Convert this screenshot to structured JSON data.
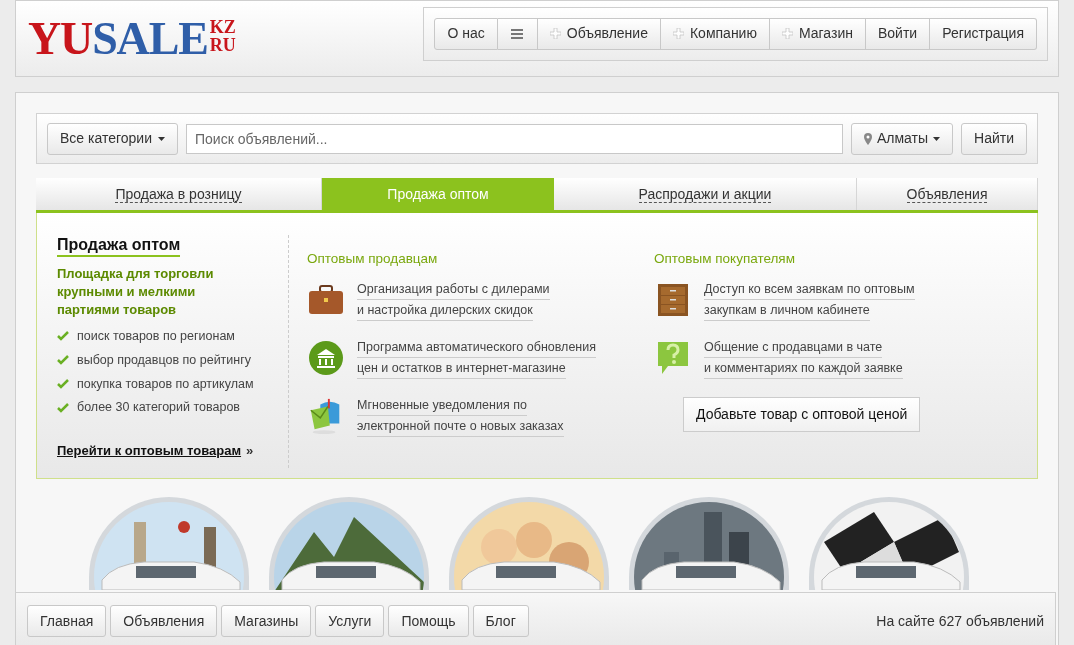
{
  "logo": {
    "main_red": "YU",
    "main_blue": "SALE",
    "top": "KZ",
    "bottom": "RU"
  },
  "nav": [
    {
      "kind": "text",
      "label": "О нас"
    },
    {
      "kind": "menu"
    },
    {
      "kind": "add",
      "label": "Объявление"
    },
    {
      "kind": "add",
      "label": "Компанию"
    },
    {
      "kind": "add",
      "label": "Магазин"
    },
    {
      "kind": "text",
      "label": "Войти"
    },
    {
      "kind": "text",
      "label": "Регистрация"
    }
  ],
  "search": {
    "category": "Все категории",
    "placeholder": "Поиск объявлений...",
    "city": "Алматы",
    "button": "Найти"
  },
  "tabs": [
    {
      "label": "Продажа в розницу",
      "selected": false
    },
    {
      "label": "Продажа оптом",
      "selected": true
    },
    {
      "label": "Распродажи и акции",
      "selected": false
    },
    {
      "label": "Объявления",
      "selected": false
    }
  ],
  "panel": {
    "title": "Продажа оптом",
    "subtitle": "Площадка для торговли крупными и мелкими партиями товаров",
    "features": [
      "поиск товаров по регионам",
      "выбор продавцов по рейтингу",
      "покупка товаров по артикулам",
      "более 30 категорий товаров"
    ],
    "link": "Перейти к оптовым товарам",
    "link_suffix": "»",
    "columns": [
      {
        "heading": "Оптовым продавцам",
        "items": [
          {
            "kind": "briefcase",
            "lines": [
              "Организация работы с дилерами",
              "и настройка дилерских скидок"
            ]
          },
          {
            "kind": "bank",
            "lines": [
              "Программа автоматического обновления",
              "цен и остатков в интернет-магазине"
            ]
          },
          {
            "kind": "mailbox",
            "lines": [
              "Мгновенные уведомления по",
              "электронной почте о новых заказах"
            ]
          }
        ]
      },
      {
        "heading": "Оптовым покупателям",
        "items": [
          {
            "kind": "cabinet",
            "lines": [
              "Доступ ко всем заявкам по оптовым",
              "закупкам в личном кабинете"
            ]
          },
          {
            "kind": "question",
            "lines": [
              "Общение с продавцами в чате",
              "и комментариях по каждой заявке"
            ]
          }
        ],
        "button": "Добавьте товар с оптовой ценой"
      }
    ]
  },
  "footer": {
    "links": [
      "Главная",
      "Объявления",
      "Магазины",
      "Услуги",
      "Помощь",
      "Блог"
    ],
    "status": "На сайте 627 объявлений"
  }
}
